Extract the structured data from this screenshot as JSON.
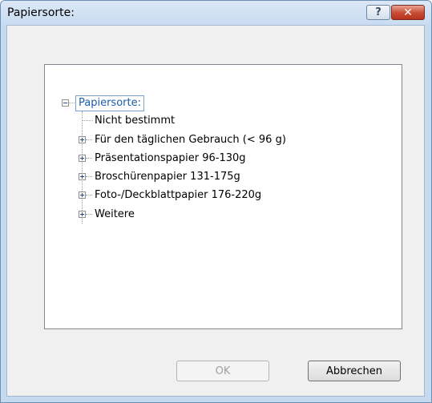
{
  "window": {
    "title": "Papiersorte:"
  },
  "titlebar": {
    "help_label": "?",
    "close_label": "✕"
  },
  "tree": {
    "root_label": "Papiersorte:",
    "items": [
      {
        "label": "Nicht bestimmt",
        "expandable": false
      },
      {
        "label": "Für den täglichen Gebrauch (< 96 g)",
        "expandable": true
      },
      {
        "label": "Präsentationspapier 96-130g",
        "expandable": true
      },
      {
        "label": "Broschürenpapier 131-175g",
        "expandable": true
      },
      {
        "label": "Foto-/Deckblattpapier 176-220g",
        "expandable": true
      },
      {
        "label": "Weitere",
        "expandable": true
      }
    ]
  },
  "buttons": {
    "ok_label": "OK",
    "cancel_label": "Abbrechen"
  }
}
